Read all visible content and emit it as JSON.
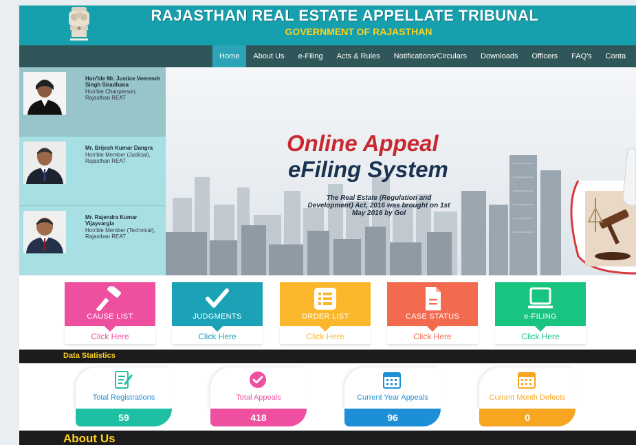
{
  "header": {
    "title": "RAJASTHAN REAL ESTATE APPELLATE TRIBUNAL",
    "subtitle": "GOVERNMENT OF RAJASTHAN",
    "emblem_icon": "state-emblem-icon"
  },
  "nav": {
    "items": [
      "Home",
      "About Us",
      "e-Filing",
      "Acts & Rules",
      "Notifications/Circulars",
      "Downloads",
      "Officers",
      "FAQ's",
      "Conta"
    ],
    "active": "Home"
  },
  "sidebar": {
    "members": [
      {
        "name": "Hon'ble Mr. Justice Veerendr Singh Siradhana",
        "role": "Hon'ble Chairperson, Rajasthan REAT",
        "bg": "#97c5c9"
      },
      {
        "name": "Mr. Brijesh Kumar Dangra",
        "role": "Hon'ble Member (Judicial), Rajasthan REAT",
        "bg": "#a8dfe3"
      },
      {
        "name": "Mr. Rajendra Kumar Vijayvargia",
        "role": "Hon'ble Member (Technical), Rajasthan REAT",
        "bg": "#a8dfe3"
      }
    ]
  },
  "banner": {
    "title1": "Online Appeal",
    "title2": "eFiling System",
    "text": "The Real Estate (Regulation and Development) Act, 2016 was brought on 1st May 2016 by GoI"
  },
  "quick_links": [
    {
      "label": "CAUSE LIST",
      "action": "Click Here",
      "color": "#ee4f9f",
      "icon": "gavel-icon"
    },
    {
      "label": "JUDGMENTS",
      "action": "Click Here",
      "color": "#1ba2b6",
      "icon": "checkmark-icon"
    },
    {
      "label": "ORDER LIST",
      "action": "Click Here",
      "color": "#fbb72c",
      "icon": "list-icon"
    },
    {
      "label": "CASE STATUS",
      "action": "Click Here",
      "color": "#f46a4f",
      "icon": "document-icon"
    },
    {
      "label": "e-FILING",
      "action": "Click Here",
      "color": "#19c380",
      "icon": "laptop-icon"
    }
  ],
  "stats": {
    "heading": "Data Statistics",
    "items": [
      {
        "label": "Total Registrations",
        "value": "59",
        "color": "#1fbfa4",
        "icon": "registration-icon"
      },
      {
        "label": "Total Appeals",
        "value": "418",
        "color": "#ee4f9f",
        "icon": "check-circle-icon"
      },
      {
        "label": "Current Year Appeals",
        "value": "96",
        "color": "#1d8fd6",
        "icon": "calendar-icon"
      },
      {
        "label": "Current Month Defects",
        "value": "0",
        "color": "#f8a521",
        "icon": "calendar-month-icon"
      }
    ]
  },
  "about": {
    "heading": "About Us"
  }
}
